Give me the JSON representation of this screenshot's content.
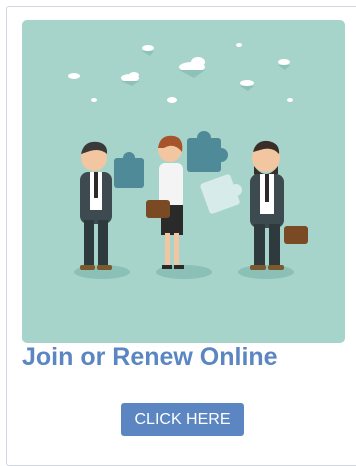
{
  "hero": {
    "image_icon": "business-team-puzzle-illustration",
    "background_color": "#a6d3ca"
  },
  "main": {
    "heading": "Join or Renew Online",
    "cta_label": "CLICK HERE"
  },
  "colors": {
    "accent": "#5b86c2",
    "card_border": "#cfd6df"
  }
}
